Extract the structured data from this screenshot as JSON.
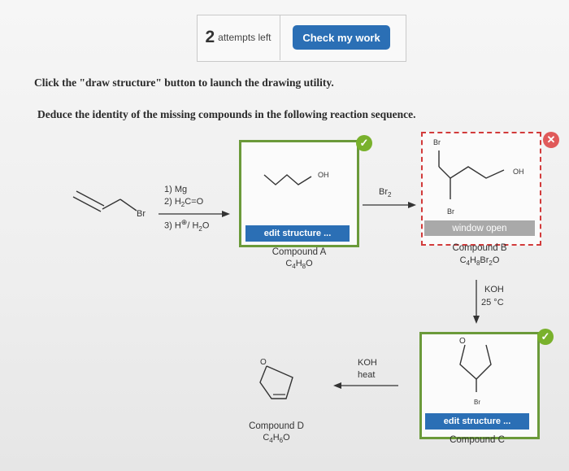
{
  "toolbar": {
    "attempts_count": "2",
    "attempts_label": "attempts left",
    "check_label": "Check my work"
  },
  "instructions": {
    "line1": "Click the \"draw structure\" button to launch the drawing utility.",
    "line2": "Deduce the identity of the missing compounds in the following reaction sequence."
  },
  "starting_material": {
    "br_label": "Br"
  },
  "step1": {
    "reagent1": "1) Mg",
    "reagent2_prefix": "2) H",
    "reagent2_sub": "2",
    "reagent2_suffix": "C=O",
    "reagent3_prefix": "3) H",
    "reagent3_sup": "⊕",
    "reagent3_mid": "/ H",
    "reagent3_sub": "2",
    "reagent3_suffix": "O"
  },
  "compound_a": {
    "oh_label": "OH",
    "edit_label": "edit structure ...",
    "name": "Compound A",
    "formula": {
      "c": "C",
      "c_n": "4",
      "h": "H",
      "h_n": "8",
      "o": "O"
    }
  },
  "step2": {
    "reagent_prefix": "Br",
    "reagent_sub": "2"
  },
  "compound_b": {
    "br_top": "Br",
    "br_bottom": "Br",
    "oh_label": "OH",
    "window_label": "window open",
    "name": "Compound B",
    "formula": {
      "c": "C",
      "c_n": "4",
      "h": "H",
      "h_n": "8",
      "br": "Br",
      "br_n": "2",
      "o": "O"
    }
  },
  "step3": {
    "reagent1": "KOH",
    "reagent2": "25 °C"
  },
  "compound_c": {
    "o_label": "O",
    "br_label": "Br",
    "edit_label": "edit structure ...",
    "name": "Compound C"
  },
  "step4": {
    "reagent1": "KOH",
    "reagent2": "heat"
  },
  "compound_d": {
    "o_label": "O",
    "name": "Compound D",
    "formula": {
      "c": "C",
      "c_n": "4",
      "h": "H",
      "h_n": "6",
      "o": "O"
    }
  },
  "icons": {
    "check": "check-icon",
    "close": "close-icon"
  },
  "colors": {
    "accent_blue": "#2b6fb5",
    "correct_green": "#6b9a3a",
    "wrong_red": "#d23b3b"
  }
}
